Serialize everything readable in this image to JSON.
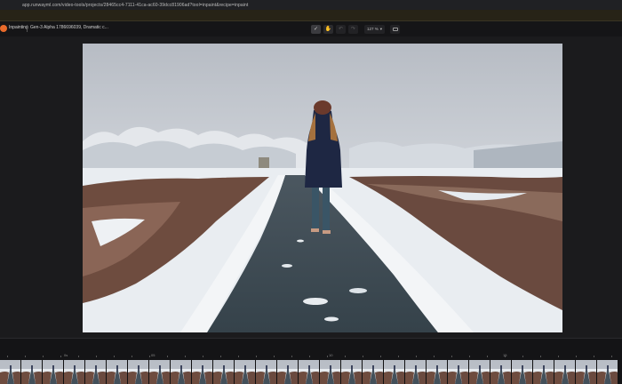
{
  "browser": {
    "url": "app.runwayml.com/video-tools/projects/28465cc4-7111-41ca-ac60-39dcc81906ad?tool=inpaint&recipe=inpaint"
  },
  "appbar": {
    "tool_name": "Inpainting",
    "model_name": "Gen-3 Alpha 1786696039, Dramatic c..."
  },
  "toolbar": {
    "brush_icon": "brush-icon",
    "hand_icon": "hand-icon",
    "undo_icon": "undo-icon",
    "redo_icon": "redo-icon",
    "zoom_label": "127 %",
    "layout_icon": "layout-icon"
  },
  "timeline": {
    "marks": [
      "0s",
      "05",
      "10",
      "15"
    ],
    "thumbnail_count": 29
  },
  "colors": {
    "accent": "#e86a2a",
    "background": "#1b1b1d"
  }
}
